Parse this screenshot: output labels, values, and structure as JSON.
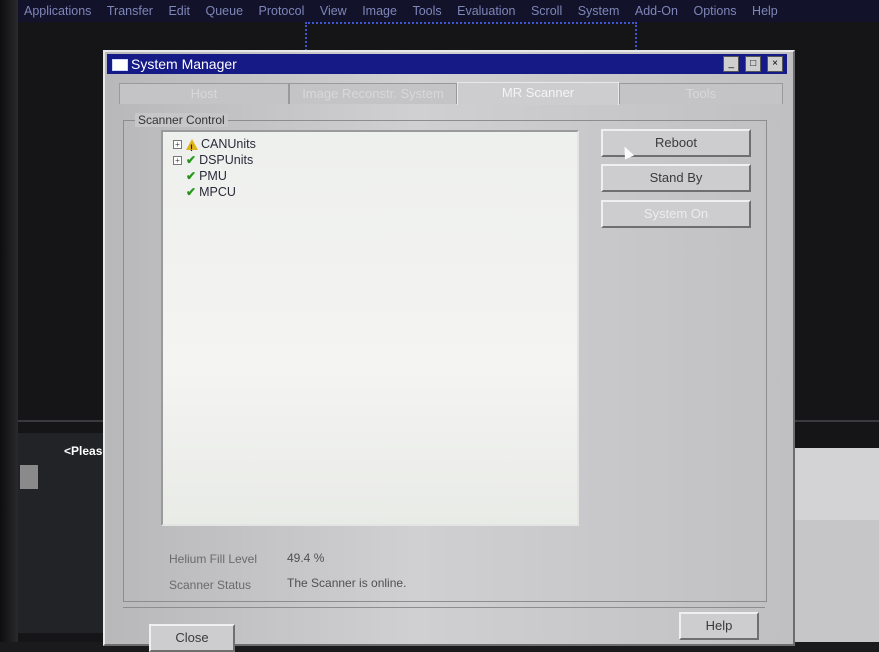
{
  "menubar": {
    "items": [
      "Applications",
      "Transfer",
      "Edit",
      "Queue",
      "Protocol",
      "View",
      "Image",
      "Tools",
      "Evaluation",
      "Scroll",
      "System",
      "Add-On",
      "Options",
      "Help"
    ]
  },
  "background": {
    "status_text": "<Please re"
  },
  "dialog": {
    "title": "System Manager",
    "window_buttons": [
      "_",
      "□",
      "×"
    ],
    "tabs": [
      {
        "label": "Host",
        "active": false
      },
      {
        "label": "Image Reconstr. System",
        "active": false
      },
      {
        "label": "MR Scanner",
        "active": true
      },
      {
        "label": "Tools",
        "active": false
      }
    ],
    "group_label": "Scanner Control",
    "tree": [
      {
        "label": "CANUnits",
        "status": "warning",
        "expandable": true
      },
      {
        "label": "DSPUnits",
        "status": "ok",
        "expandable": true
      },
      {
        "label": "PMU",
        "status": "ok",
        "expandable": false
      },
      {
        "label": "MPCU",
        "status": "ok",
        "expandable": false
      }
    ],
    "buttons": {
      "reboot": "Reboot",
      "standby": "Stand By",
      "system_on": "System On",
      "help": "Help",
      "close": "Close"
    },
    "status": {
      "helium_label": "Helium Fill Level",
      "helium_value": "49.4 %",
      "scanner_label": "Scanner Status",
      "scanner_value": "The Scanner is online."
    }
  },
  "colors": {
    "titlebar": "#161a86",
    "ok": "#26951c",
    "warning": "#e0b21c"
  }
}
